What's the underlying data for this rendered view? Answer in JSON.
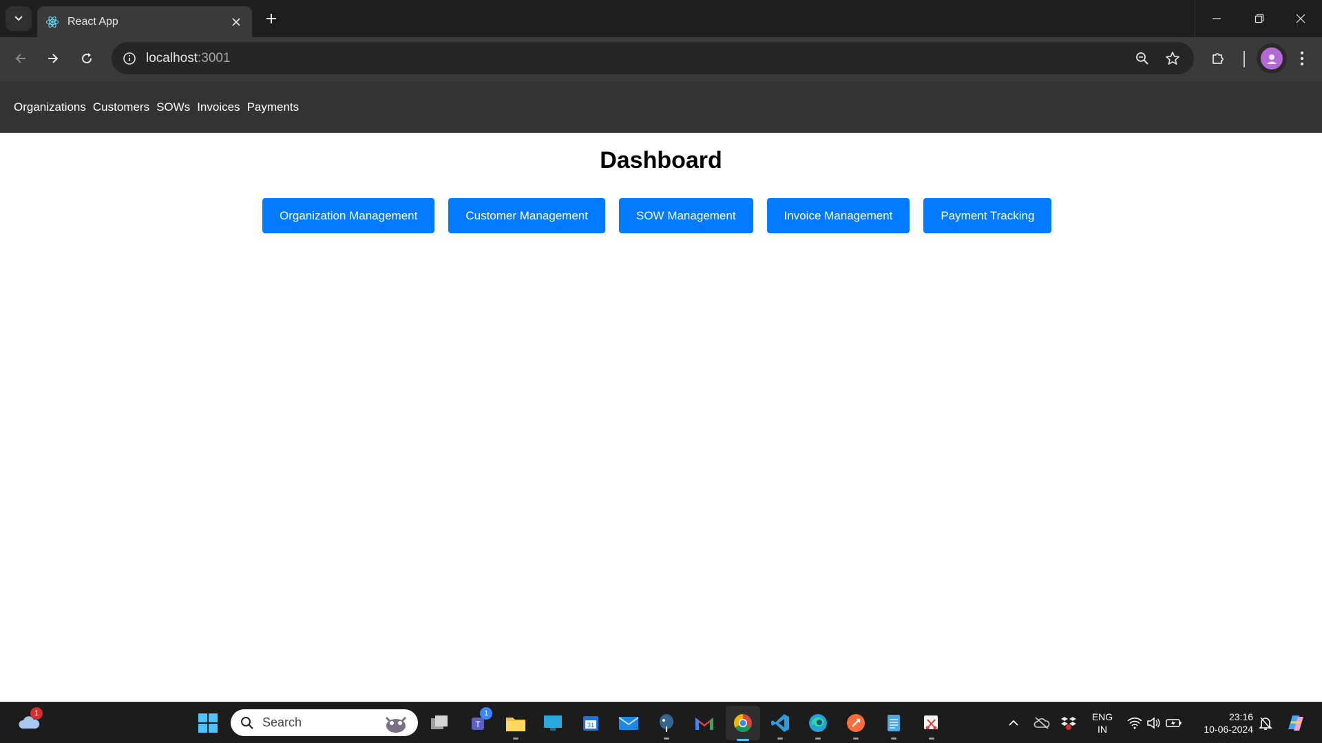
{
  "browser": {
    "tab_title": "React App",
    "url_host": "localhost",
    "url_port": ":3001"
  },
  "nav": {
    "items": [
      "Organizations",
      "Customers",
      "SOWs",
      "Invoices",
      "Payments"
    ]
  },
  "main": {
    "title": "Dashboard",
    "buttons": [
      "Organization Management",
      "Customer Management",
      "SOW Management",
      "Invoice Management",
      "Payment Tracking"
    ]
  },
  "taskbar": {
    "search_label": "Search",
    "weather_badge": "1",
    "teams_badge": "1",
    "lang_line1": "ENG",
    "lang_line2": "IN",
    "time": "23:16",
    "date": "10-06-2024"
  },
  "colors": {
    "primary_button": "#007bff",
    "nav_bar": "#333333"
  }
}
